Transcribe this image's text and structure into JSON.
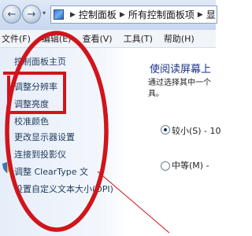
{
  "address_bar": {
    "crumbs": [
      "控制面板",
      "所有控制面板项",
      "显"
    ]
  },
  "menu": {
    "items": [
      "文件(F)",
      "编辑(E)",
      "查看(V)",
      "工具(T)",
      "帮助(H)"
    ]
  },
  "sidebar": {
    "links": [
      "控制面板主页",
      "调整分辨率",
      "调整亮度",
      "校准颜色",
      "更改显示器设置",
      "连接到投影仪",
      "调整 ClearType 文",
      "设置自定义文本大小(DPI)"
    ]
  },
  "content": {
    "heading": "使阅读屏幕上",
    "description_line1": "通过选择其中一个",
    "description_line2": "具。",
    "options": [
      {
        "label": "较小(S) - 10",
        "checked": true
      },
      {
        "label": "中等(M) -",
        "checked": false
      }
    ]
  },
  "colors": {
    "annotation": "#d0151b",
    "heading": "#1e3287",
    "link": "#1e395b"
  },
  "icons": [
    "back-arrow-icon",
    "forward-arrow-icon",
    "control-panel-icon",
    "shield-icon"
  ]
}
